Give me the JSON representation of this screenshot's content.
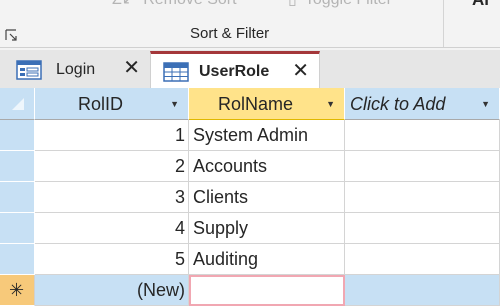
{
  "ribbon": {
    "remove_sort_label": "Remove Sort",
    "toggle_filter_label": "Toggle Filter",
    "group_label": "Sort & Filter",
    "cut_label": "Al"
  },
  "tabs": [
    {
      "label": "Login",
      "close": "✕"
    },
    {
      "label": "UserRole",
      "close": "✕"
    }
  ],
  "datasheet": {
    "columns": [
      {
        "label": "RolID",
        "dropdown": "▼"
      },
      {
        "label": "RolName",
        "dropdown": "▼"
      },
      {
        "label": "Click to Add",
        "dropdown": "▼"
      }
    ],
    "rows": [
      {
        "id": "1",
        "name": "System Admin"
      },
      {
        "id": "2",
        "name": "Accounts"
      },
      {
        "id": "3",
        "name": "Clients"
      },
      {
        "id": "4",
        "name": "Supply"
      },
      {
        "id": "5",
        "name": "Auditing"
      }
    ],
    "new_row": {
      "marker": "✳",
      "id": "(New)",
      "name": ""
    }
  },
  "colors": {
    "selected_header": "#ffe38a",
    "header": "#c7e0f4",
    "tab_accent": "#a4373a"
  }
}
